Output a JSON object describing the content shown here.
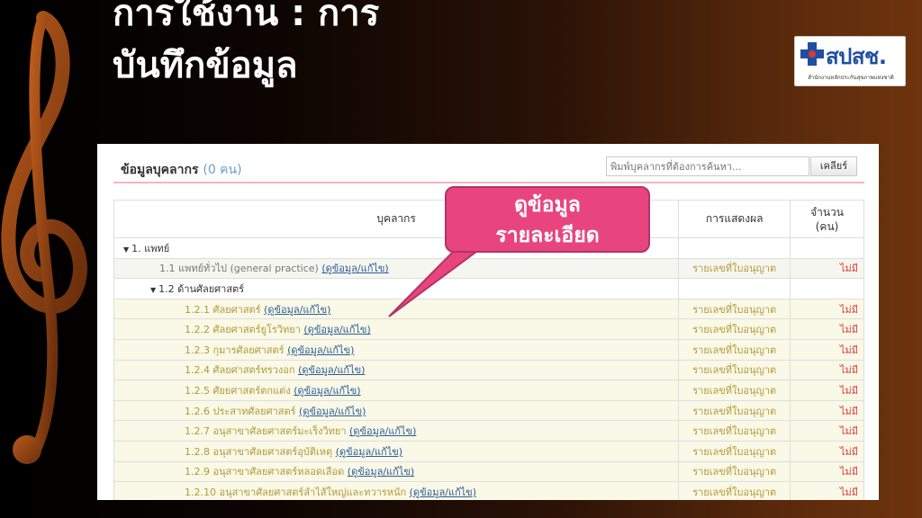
{
  "slide": {
    "title_line1": "การใช้งาน : การ",
    "title_line2": "บันทึกข้อมูล"
  },
  "logo": {
    "text": "สปสช.",
    "subtitle": "สำนักงานหลักประกันสุขภาพแห่งชาติ"
  },
  "panel": {
    "title": "ข้อมูลบุคลากร",
    "count": "(0 คน)",
    "search_placeholder": "พิมพ์บุคลากรที่ต้องการค้นหา...",
    "clear_label": "เคลียร์"
  },
  "table": {
    "headers": {
      "personnel": "บุคลากร",
      "display": "การแสดงผล",
      "count": "จำนวน (คน)"
    },
    "rows": [
      {
        "label": "1. แพทย์",
        "link": "",
        "display": "",
        "count": ""
      },
      {
        "label": "1.1 แพทย์ทั่วไป (general practice)",
        "link": "(ดูข้อมูล/แก้ไข)",
        "display": "รายเลขที่ใบอนุญาต",
        "count": "ไม่มี"
      },
      {
        "label": "1.2 ด้านศัลยศาสตร์",
        "link": "",
        "display": "",
        "count": ""
      },
      {
        "label": "1.2.1 ศัลยศาสตร์",
        "link": "(ดูข้อมูล/แก้ไข)",
        "display": "รายเลขที่ใบอนุญาต",
        "count": "ไม่มี"
      },
      {
        "label": "1.2.2 ศัลยศาสตร์ยูโรวิทยา",
        "link": "(ดูข้อมูล/แก้ไข)",
        "display": "รายเลขที่ใบอนุญาต",
        "count": "ไม่มี"
      },
      {
        "label": "1.2.3 กุมารศัลยศาสตร์",
        "link": "(ดูข้อมูล/แก้ไข)",
        "display": "รายเลขที่ใบอนุญาต",
        "count": "ไม่มี"
      },
      {
        "label": "1.2.4 ศัลยศาสตร์ทรวงอก",
        "link": "(ดูข้อมูล/แก้ไข)",
        "display": "รายเลขที่ใบอนุญาต",
        "count": "ไม่มี"
      },
      {
        "label": "1.2.5 ศัยยศาสตร์ตกแต่ง",
        "link": "(ดูข้อมูล/แก้ไข)",
        "display": "รายเลขที่ใบอนุญาต",
        "count": "ไม่มี"
      },
      {
        "label": "1.2.6 ประสาทศัลยศาสตร์",
        "link": "(ดูข้อมูล/แก้ไข)",
        "display": "รายเลขที่ใบอนุญาต",
        "count": "ไม่มี"
      },
      {
        "label": "1.2.7 อนุสาขาศัลยศาสตร์มะเร็งวิทยา",
        "link": "(ดูข้อมูล/แก้ไข)",
        "display": "รายเลขที่ใบอนุญาต",
        "count": "ไม่มี"
      },
      {
        "label": "1.2.8 อนุสาขาศัลยศาสตร์อุบัติเหตุ",
        "link": "(ดูข้อมูล/แก้ไข)",
        "display": "รายเลขที่ใบอนุญาต",
        "count": "ไม่มี"
      },
      {
        "label": "1.2.9 อนุสาขาศัลยศาสตร์หลอดเลือด",
        "link": "(ดูข้อมูล/แก้ไข)",
        "display": "รายเลขที่ใบอนุญาต",
        "count": "ไม่มี"
      },
      {
        "label": "1.2.10 อนุสาขาศัลยศาสตร์ลำไส้ใหญ่และทวารหนัก",
        "link": "(ดูข้อมูล/แก้ไข)",
        "display": "รายเลขที่ใบอนุญาต",
        "count": "ไม่มี"
      }
    ]
  },
  "callout": {
    "line1": "ดูข้อมูล",
    "line2": "รายละเอียด"
  },
  "colors": {
    "callout": "#e8457f",
    "link": "#2a5d99",
    "none_status": "#d63a3a",
    "display_text": "#b39a3c"
  }
}
